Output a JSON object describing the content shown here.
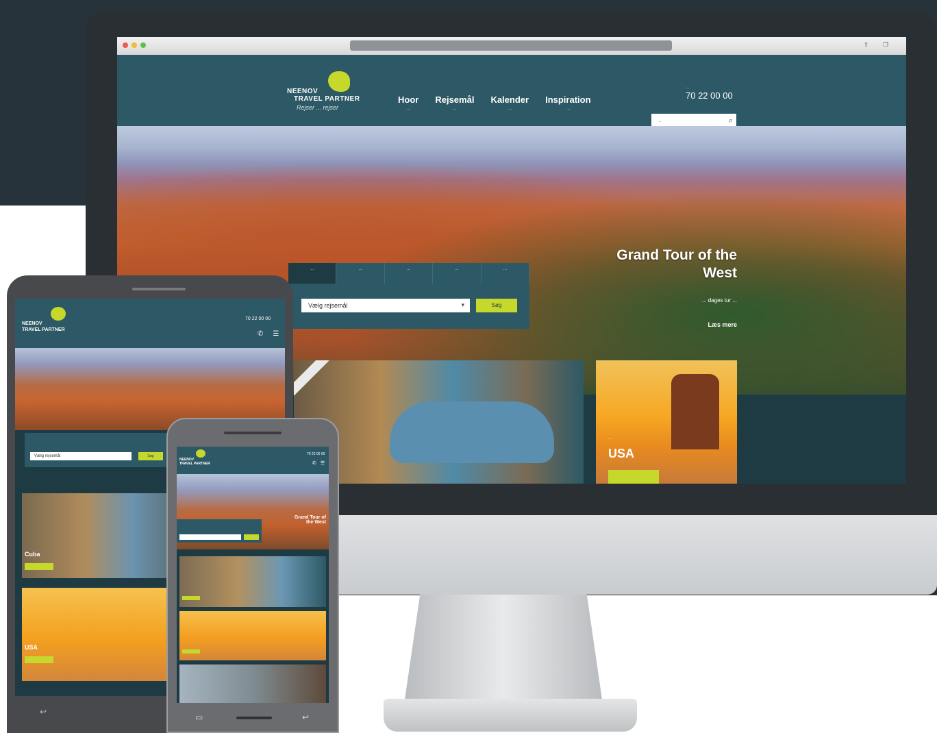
{
  "browser": {
    "url": "",
    "icons": [
      "share-icon",
      "tabs-icon"
    ]
  },
  "header": {
    "logo_line1": "NEENOV",
    "logo_line2": "TRAVEL PARTNER",
    "logo_tagline": "Rejser ... rejser",
    "nav": [
      {
        "label": "Hoor",
        "sub": "..."
      },
      {
        "label": "Rejsemål",
        "sub": "..."
      },
      {
        "label": "Kalender",
        "sub": "..."
      },
      {
        "label": "Inspiration",
        "sub": "..."
      }
    ],
    "phone_label": "...",
    "phone": "70 22 00 00",
    "search_placeholder": "...",
    "search_icon": "search-icon"
  },
  "hero": {
    "title": "Grand Tour of the West",
    "description": "... dages tur ...",
    "link_label": "Læs mere"
  },
  "booking": {
    "tabs": [
      "...",
      "...",
      "...",
      "...",
      "..."
    ],
    "select_value": "Vælg rejsemål",
    "button_label": "Søg"
  },
  "tiles": {
    "usa_label": "...",
    "usa_name": "USA"
  },
  "tablet": {
    "phone": "70 22 00 00",
    "tile1_name": "Cuba",
    "tile2_name": "USA",
    "select_value": "Vælg rejsemål",
    "button_label": "Søg"
  },
  "phone": {
    "phone": "70 22 00 00",
    "hero_title": "Grand Tour of the West"
  },
  "colors": {
    "header_teal": "#2d5966",
    "dark_teal": "#1e3a42",
    "accent_lime": "#c6d82c",
    "background_dark": "#27333b"
  }
}
